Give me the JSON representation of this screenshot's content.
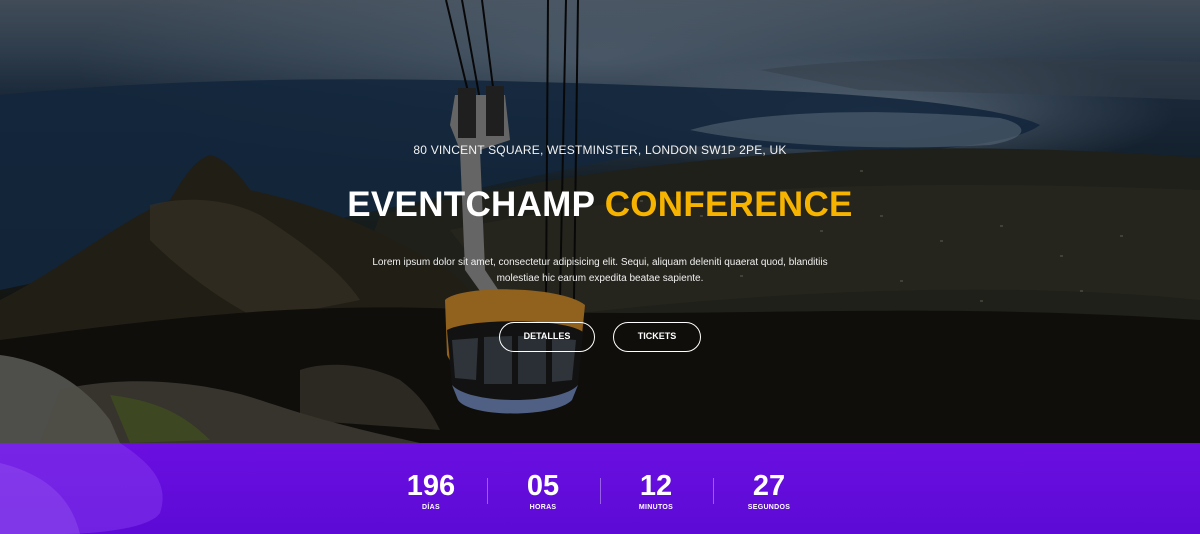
{
  "hero": {
    "address": "80 VINCENT SQUARE, WESTMINSTER, LONDON SW1P 2PE, UK",
    "title_main": "EVENTCHAMP",
    "title_accent": "CONFERENCE",
    "description": "Lorem ipsum dolor sit amet, consectetur adipisicing elit. Sequi, aliquam deleniti quaerat quod, blanditiis molestiae hic earum expedita beatae sapiente.",
    "buttons": {
      "details": "DETALLES",
      "tickets": "TICKETS"
    }
  },
  "countdown": {
    "items": [
      {
        "value": "196",
        "label": "DÍAS"
      },
      {
        "value": "05",
        "label": "HORAS"
      },
      {
        "value": "12",
        "label": "MINUTOS"
      },
      {
        "value": "27",
        "label": "SEGUNDOS"
      }
    ]
  },
  "colors": {
    "accent": "#f6b300",
    "countdown_bg": "#6a0fe0"
  },
  "icons": []
}
